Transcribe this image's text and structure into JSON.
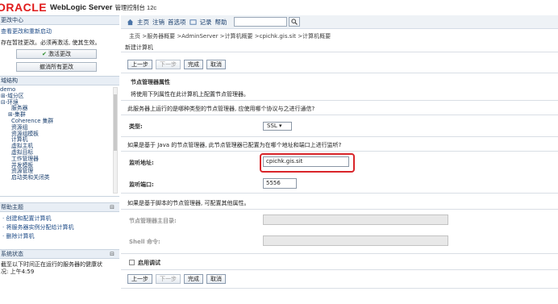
{
  "header": {
    "logo": "ORACLE",
    "product": "WebLogic Server",
    "product_sub": "管理控制台 12c"
  },
  "toolbar": {
    "items": [
      "主页",
      "注销",
      "首选项",
      "记录",
      "帮助"
    ]
  },
  "breadcrumb": "主页 >服务器概要 >AdminServer >计算机概要 >cpichk.gis.sit >计算机概要",
  "change_center": {
    "title": "更改中心",
    "link": "查看更改和重新启动",
    "desc": "存在暂挂更改。必须再激活, 使其生效。",
    "activate": "激活更改",
    "undo": "撤消所有更改"
  },
  "domain_structure": {
    "title": "域结构",
    "items": [
      "demo",
      "⊞-域分区",
      "⊟-环境",
      "服务器",
      "⊞-集群",
      "Coherence 集群",
      "资源组",
      "资源组模板",
      "计算机",
      "虚拟主机",
      "虚拟目标",
      "工作管理器",
      "并发模板",
      "资源管理",
      "启动类和关闭类"
    ]
  },
  "help_topics": {
    "title": "帮助主题",
    "items": [
      "创建和配置计算机",
      "将服务器实例分配给计算机",
      "删除计算机"
    ]
  },
  "system_status": {
    "title": "系统状态",
    "line1": "截至以下时间正在运行的服务器的健康状",
    "line2": "况: 上午4:59"
  },
  "main": {
    "section_title": "新建计算机",
    "buttons": {
      "back": "上一步",
      "next": "下一步",
      "finish": "完成",
      "cancel": "取消"
    },
    "nm_title": "节点管理器属性",
    "nm_desc": "将使用下列属性在此计算机上配置节点管理器。",
    "nm_question": "此服务器上运行的是哪种类型的节点管理器, 应使用哪个协议与之进行通信?",
    "type_label": "类型:",
    "type_value": "SSL",
    "java_note": "如果是基于 Java 的节点管理器, 此节点管理器已配置为在哪个地址和端口上进行监听?",
    "listen_addr_label": "监听地址:",
    "listen_addr_value": "cpichk.gis.sit",
    "listen_port_label": "监听端口:",
    "listen_port_value": "5556",
    "script_note": "如果是基于脚本的节点管理器, 可配置其他属性。",
    "home_label": "节点管理器主目录:",
    "shell_label": "Shell 命令:",
    "debug_label": "启用调试"
  },
  "colors": {
    "highlight": "#d9252a",
    "brand": "#e01b1b"
  }
}
